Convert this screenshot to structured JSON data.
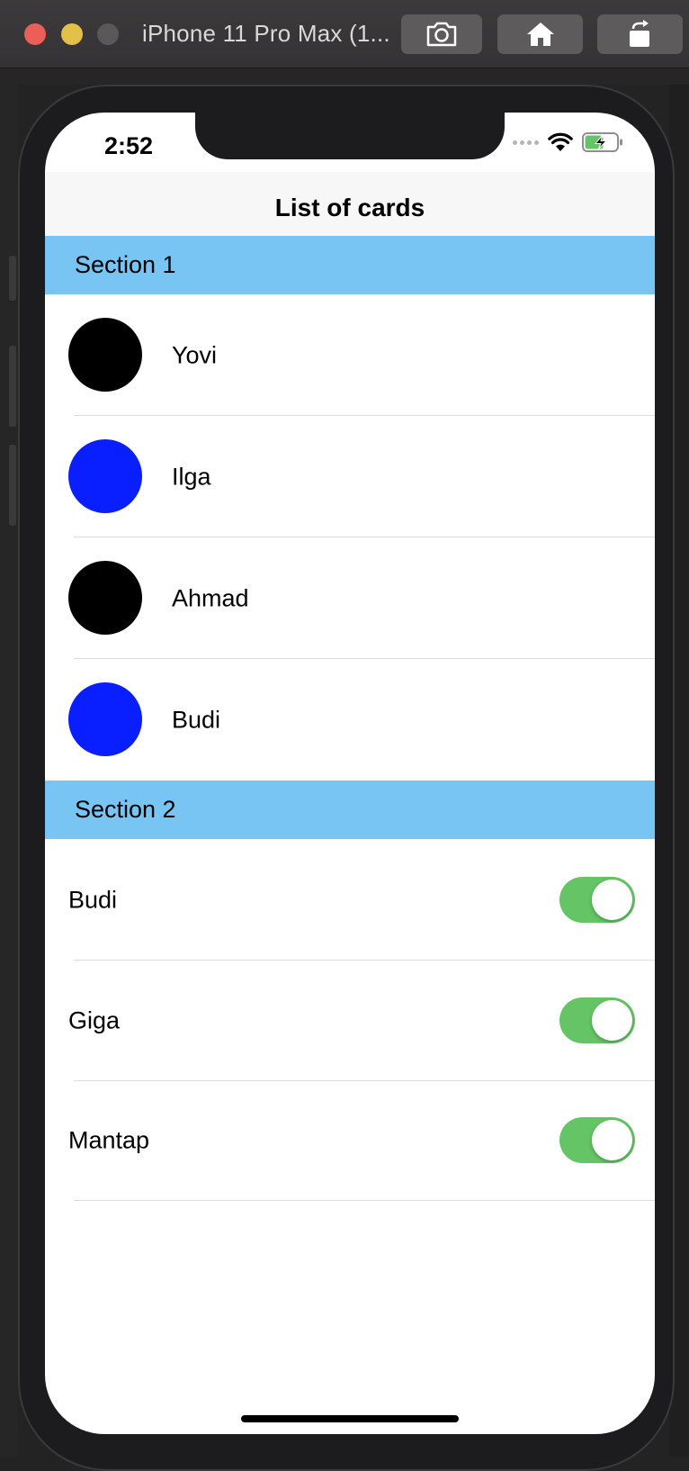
{
  "window": {
    "title": "iPhone 11 Pro Max (1...",
    "buttons": [
      {
        "name": "screenshot",
        "icon": "camera-icon"
      },
      {
        "name": "home",
        "icon": "home-icon"
      },
      {
        "name": "rotate",
        "icon": "rotate-icon"
      }
    ]
  },
  "status_bar": {
    "time": "2:52",
    "battery": "charging"
  },
  "nav": {
    "title": "List of cards"
  },
  "sections": [
    {
      "header": "Section 1",
      "rows": [
        {
          "label": "Yovi",
          "avatar_color": "#000000"
        },
        {
          "label": "Ilga",
          "avatar_color": "#0a1fff"
        },
        {
          "label": "Ahmad",
          "avatar_color": "#000000"
        },
        {
          "label": "Budi",
          "avatar_color": "#0a1fff"
        }
      ]
    },
    {
      "header": "Section 2",
      "rows": [
        {
          "label": "Budi",
          "toggle_on": true
        },
        {
          "label": "Giga",
          "toggle_on": true
        },
        {
          "label": "Mantap",
          "toggle_on": true
        }
      ]
    }
  ],
  "colors": {
    "section_header_bg": "#78c5f3",
    "toggle_on": "#65c466"
  }
}
